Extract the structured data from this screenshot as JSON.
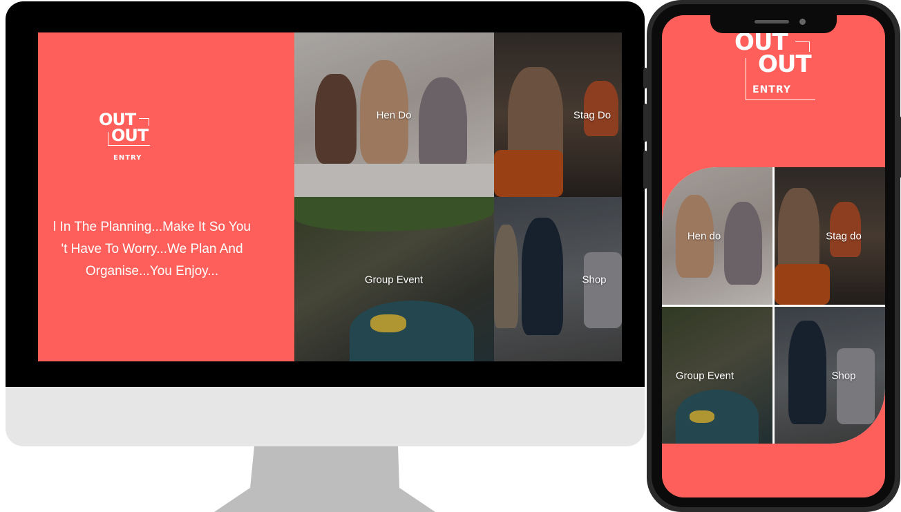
{
  "brand": {
    "line1": "OUT",
    "line2": "OUT",
    "line3": "ENTRY"
  },
  "desktop": {
    "tagline": "l In The Planning...Make It So You\n't Have To Worry...We Plan And\nOrganise...You Enjoy...",
    "tiles": [
      {
        "label": "Hen Do"
      },
      {
        "label": "Stag Do"
      },
      {
        "label": "Group Event"
      },
      {
        "label": "Shop"
      }
    ]
  },
  "mobile": {
    "tiles": [
      {
        "label": "Hen do"
      },
      {
        "label": "Stag do"
      },
      {
        "label": "Group Event"
      },
      {
        "label": "Shop"
      }
    ]
  },
  "colors": {
    "accent": "#ff5f5a",
    "bezel": "#000000",
    "chin": "#e6e6e6",
    "stand": "#bdbdbd"
  }
}
